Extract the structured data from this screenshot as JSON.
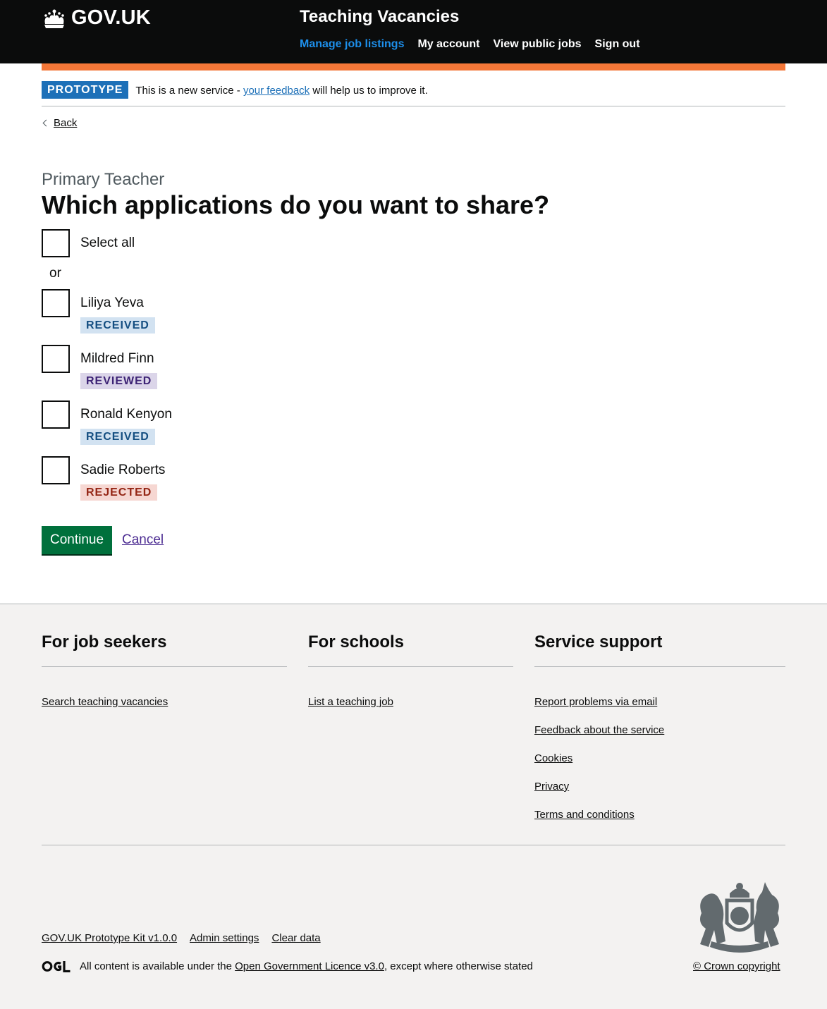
{
  "header": {
    "logo_text": "GOV.UK",
    "service_name": "Teaching Vacancies",
    "nav": [
      {
        "label": "Manage job listings",
        "active": true
      },
      {
        "label": "My account",
        "active": false
      },
      {
        "label": "View public jobs",
        "active": false
      },
      {
        "label": "Sign out",
        "active": false
      }
    ]
  },
  "phase_banner": {
    "tag": "PROTOTYPE",
    "text_before": "This is a new service - ",
    "link": "your feedback",
    "text_after": " will help us to improve it."
  },
  "back_link": "Back",
  "caption": "Primary Teacher",
  "heading": "Which applications do you want to share?",
  "select_all_label": "Select all",
  "or_text": "or",
  "applicants": [
    {
      "name": "Liliya Yeva",
      "status": "RECEIVED"
    },
    {
      "name": "Mildred Finn",
      "status": "REVIEWED"
    },
    {
      "name": "Ronald Kenyon",
      "status": "RECEIVED"
    },
    {
      "name": "Sadie Roberts",
      "status": "REJECTED"
    }
  ],
  "actions": {
    "continue": "Continue",
    "cancel": "Cancel"
  },
  "footer": {
    "job_seekers": {
      "title": "For job seekers",
      "links": [
        "Search teaching vacancies"
      ]
    },
    "schools": {
      "title": "For schools",
      "links": [
        "List a teaching job"
      ]
    },
    "support": {
      "title": "Service support",
      "links": [
        "Report problems via email",
        "Feedback about the service",
        "Cookies",
        "Privacy",
        "Terms and conditions"
      ]
    },
    "meta_links": [
      "GOV.UK Prototype Kit v1.0.0",
      "Admin settings",
      "Clear data"
    ],
    "licence_before": "All content is available under the ",
    "licence_link": "Open Government Licence v3.0",
    "licence_after": ", except where otherwise stated",
    "copyright": "© Crown copyright"
  },
  "colors": {
    "header_bg": "#0b0c0c",
    "accent_orange": "#f47738",
    "link_blue": "#1d70b8",
    "button_green": "#00703c",
    "footer_bg": "#f3f2f1"
  }
}
